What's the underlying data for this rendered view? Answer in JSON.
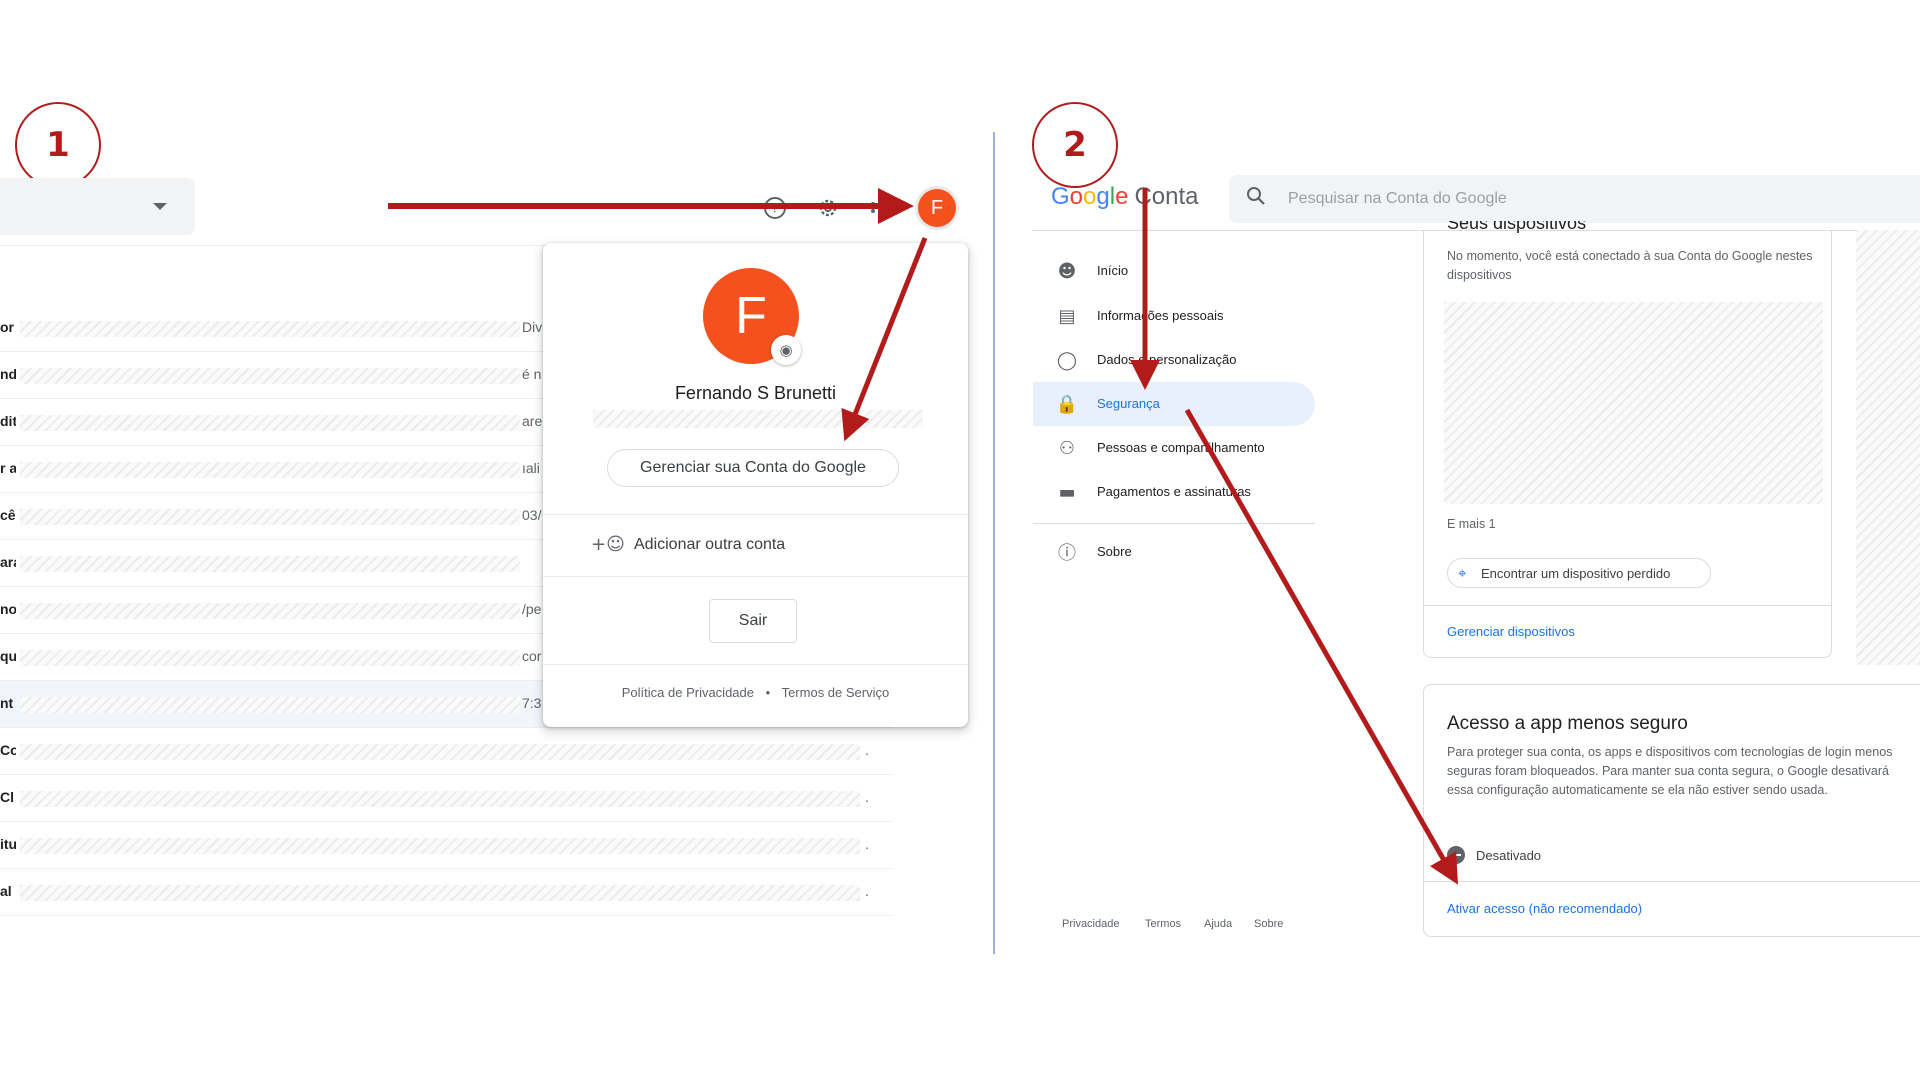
{
  "steps": [
    "1",
    "2"
  ],
  "gmail": {
    "avatar_letter": "F",
    "toolbar_icons": [
      "help-icon",
      "gear-icon",
      "apps-grid-icon"
    ],
    "mail_rows": [
      {
        "sender": "or",
        "tail": "Div"
      },
      {
        "sender": "nd",
        "tail": "é n"
      },
      {
        "sender": "dit",
        "tail": "are"
      },
      {
        "sender": "r a",
        "tail": "ıali"
      },
      {
        "sender": "cê",
        "tail": "03/"
      },
      {
        "sender": "ara",
        "tail": ""
      },
      {
        "sender": "no",
        "tail": "/pe"
      },
      {
        "sender": "qu",
        "tail": "cor"
      },
      {
        "sender": "nt",
        "tail": "7:3"
      },
      {
        "sender": "Co",
        "tail": "."
      },
      {
        "sender": "Cl",
        "tail": "."
      },
      {
        "sender": "itu",
        "tail": "."
      },
      {
        "sender": "al",
        "tail": "."
      }
    ]
  },
  "account_popup": {
    "avatar_letter": "F",
    "name": "Fernando S Brunetti",
    "manage_button": "Gerenciar sua Conta do Google",
    "add_account": "Adicionar outra conta",
    "sign_out": "Sair",
    "privacy": "Política de Privacidade",
    "bullet": "•",
    "terms": "Termos de Serviço"
  },
  "account_page": {
    "logo_letters": [
      "G",
      "o",
      "o",
      "g",
      "l",
      "e"
    ],
    "logo_product": "Conta",
    "search_placeholder": "Pesquisar na Conta do Google",
    "nav": [
      {
        "label": "Início",
        "icon": "account-circle-icon"
      },
      {
        "label": "Informações pessoais",
        "icon": "id-card-icon"
      },
      {
        "label": "Dados e personalização",
        "icon": "toggle-icon"
      },
      {
        "label": "Segurança",
        "icon": "lock-icon"
      },
      {
        "label": "Pessoas e compartilhamento",
        "icon": "people-icon"
      },
      {
        "label": "Pagamentos e assinaturas",
        "icon": "credit-card-icon"
      },
      {
        "label": "Sobre",
        "icon": "info-icon"
      }
    ],
    "footer": [
      "Privacidade",
      "Termos",
      "Ajuda",
      "Sobre"
    ],
    "devices_card": {
      "title": "Seus dispositivos",
      "description": "No momento, você está conectado à sua Conta do Google nestes dispositivos",
      "more": "E mais 1",
      "find_button": "Encontrar um dispositivo perdido",
      "manage_link": "Gerenciar dispositivos"
    },
    "less_secure_card": {
      "title": "Acesso a app menos seguro",
      "description": "Para proteger sua conta, os apps e dispositivos com tecnologias de login menos seguras foram bloqueados. Para manter sua conta segura, o Google desativará essa configuração automaticamente se ela não estiver sendo usada.",
      "status": "Desativado",
      "enable_link": "Ativar acesso (não recomendado)"
    }
  },
  "colors": {
    "annotation_red": "#b31b1b",
    "avatar_orange": "#f4511e",
    "link_blue": "#1a73e8",
    "active_nav_bg": "#e8f0fe"
  }
}
